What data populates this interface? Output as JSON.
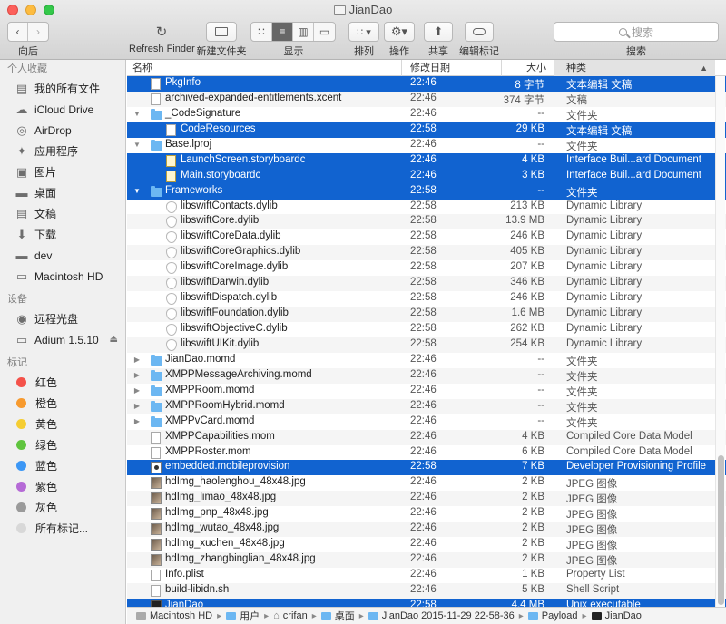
{
  "window": {
    "title": "JianDao"
  },
  "toolbar": {
    "back_label": "向后",
    "refresh_label": "Refresh Finder",
    "new_folder_label": "新建文件夹",
    "view_label": "显示",
    "arrange_label": "排列",
    "action_label": "操作",
    "share_label": "共享",
    "tags_label": "编辑标记",
    "search_label": "搜索",
    "search_placeholder": "搜索"
  },
  "sidebar": {
    "favorites_heading": "个人收藏",
    "favorites": [
      {
        "label": "我的所有文件",
        "icon": "all-files-icon"
      },
      {
        "label": "iCloud Drive",
        "icon": "cloud-icon"
      },
      {
        "label": "AirDrop",
        "icon": "airdrop-icon"
      },
      {
        "label": "应用程序",
        "icon": "applications-icon"
      },
      {
        "label": "图片",
        "icon": "camera-icon"
      },
      {
        "label": "桌面",
        "icon": "desktop-icon"
      },
      {
        "label": "文稿",
        "icon": "documents-icon"
      },
      {
        "label": "下载",
        "icon": "download-icon"
      },
      {
        "label": "dev",
        "icon": "folder-icon"
      },
      {
        "label": "Macintosh HD",
        "icon": "disk-icon"
      }
    ],
    "devices_heading": "设备",
    "devices": [
      {
        "label": "远程光盘",
        "icon": "optical-disc-icon"
      },
      {
        "label": "Adium 1.5.10",
        "icon": "disk-icon"
      }
    ],
    "tags_heading": "标记",
    "tags": [
      {
        "label": "红色",
        "color": "#f4524a"
      },
      {
        "label": "橙色",
        "color": "#f79a2e"
      },
      {
        "label": "黄色",
        "color": "#f5cd32"
      },
      {
        "label": "绿色",
        "color": "#5fc43e"
      },
      {
        "label": "蓝色",
        "color": "#3c97f5"
      },
      {
        "label": "紫色",
        "color": "#b56ad6"
      },
      {
        "label": "灰色",
        "color": "#9a9a9a"
      },
      {
        "label": "所有标记...",
        "color": "#d8d8d8"
      }
    ]
  },
  "columns": {
    "name": "名称",
    "date": "修改日期",
    "size": "大小",
    "kind": "种类"
  },
  "files": [
    {
      "name": "PkgInfo",
      "date": "22:46",
      "size": "8 字节",
      "kind": "文本编辑 文稿",
      "icon": "doc",
      "indent": 1,
      "tri": "",
      "sel": true
    },
    {
      "name": "archived-expanded-entitlements.xcent",
      "date": "22:46",
      "size": "374 字节",
      "kind": "文稿",
      "icon": "doc",
      "indent": 1,
      "tri": "",
      "sel": false
    },
    {
      "name": "_CodeSignature",
      "date": "22:46",
      "size": "--",
      "kind": "文件夹",
      "icon": "folder",
      "indent": 1,
      "tri": "▼",
      "sel": false
    },
    {
      "name": "CodeResources",
      "date": "22:58",
      "size": "29 KB",
      "kind": "文本编辑 文稿",
      "icon": "doc",
      "indent": 2,
      "tri": "",
      "sel": true
    },
    {
      "name": "Base.lproj",
      "date": "22:46",
      "size": "--",
      "kind": "文件夹",
      "icon": "folder",
      "indent": 1,
      "tri": "▼",
      "sel": false
    },
    {
      "name": "LaunchScreen.storyboardc",
      "date": "22:46",
      "size": "4 KB",
      "kind": "Interface Buil...ard Document",
      "icon": "doc-y",
      "indent": 2,
      "tri": "",
      "sel": true
    },
    {
      "name": "Main.storyboardc",
      "date": "22:46",
      "size": "3 KB",
      "kind": "Interface Buil...ard Document",
      "icon": "doc-y",
      "indent": 2,
      "tri": "",
      "sel": true
    },
    {
      "name": "Frameworks",
      "date": "22:58",
      "size": "--",
      "kind": "文件夹",
      "icon": "folder",
      "indent": 1,
      "tri": "▼",
      "sel": true
    },
    {
      "name": "libswiftContacts.dylib",
      "date": "22:58",
      "size": "213 KB",
      "kind": "Dynamic Library",
      "icon": "lib",
      "indent": 2,
      "tri": "",
      "sel": false
    },
    {
      "name": "libswiftCore.dylib",
      "date": "22:58",
      "size": "13.9 MB",
      "kind": "Dynamic Library",
      "icon": "lib",
      "indent": 2,
      "tri": "",
      "sel": false
    },
    {
      "name": "libswiftCoreData.dylib",
      "date": "22:58",
      "size": "246 KB",
      "kind": "Dynamic Library",
      "icon": "lib",
      "indent": 2,
      "tri": "",
      "sel": false
    },
    {
      "name": "libswiftCoreGraphics.dylib",
      "date": "22:58",
      "size": "405 KB",
      "kind": "Dynamic Library",
      "icon": "lib",
      "indent": 2,
      "tri": "",
      "sel": false
    },
    {
      "name": "libswiftCoreImage.dylib",
      "date": "22:58",
      "size": "207 KB",
      "kind": "Dynamic Library",
      "icon": "lib",
      "indent": 2,
      "tri": "",
      "sel": false
    },
    {
      "name": "libswiftDarwin.dylib",
      "date": "22:58",
      "size": "346 KB",
      "kind": "Dynamic Library",
      "icon": "lib",
      "indent": 2,
      "tri": "",
      "sel": false
    },
    {
      "name": "libswiftDispatch.dylib",
      "date": "22:58",
      "size": "246 KB",
      "kind": "Dynamic Library",
      "icon": "lib",
      "indent": 2,
      "tri": "",
      "sel": false
    },
    {
      "name": "libswiftFoundation.dylib",
      "date": "22:58",
      "size": "1.6 MB",
      "kind": "Dynamic Library",
      "icon": "lib",
      "indent": 2,
      "tri": "",
      "sel": false
    },
    {
      "name": "libswiftObjectiveC.dylib",
      "date": "22:58",
      "size": "262 KB",
      "kind": "Dynamic Library",
      "icon": "lib",
      "indent": 2,
      "tri": "",
      "sel": false
    },
    {
      "name": "libswiftUIKit.dylib",
      "date": "22:58",
      "size": "254 KB",
      "kind": "Dynamic Library",
      "icon": "lib",
      "indent": 2,
      "tri": "",
      "sel": false
    },
    {
      "name": "JianDao.momd",
      "date": "22:46",
      "size": "--",
      "kind": "文件夹",
      "icon": "folder",
      "indent": 1,
      "tri": "▶",
      "sel": false
    },
    {
      "name": "XMPPMessageArchiving.momd",
      "date": "22:46",
      "size": "--",
      "kind": "文件夹",
      "icon": "folder",
      "indent": 1,
      "tri": "▶",
      "sel": false
    },
    {
      "name": "XMPPRoom.momd",
      "date": "22:46",
      "size": "--",
      "kind": "文件夹",
      "icon": "folder",
      "indent": 1,
      "tri": "▶",
      "sel": false
    },
    {
      "name": "XMPPRoomHybrid.momd",
      "date": "22:46",
      "size": "--",
      "kind": "文件夹",
      "icon": "folder",
      "indent": 1,
      "tri": "▶",
      "sel": false
    },
    {
      "name": "XMPPvCard.momd",
      "date": "22:46",
      "size": "--",
      "kind": "文件夹",
      "icon": "folder",
      "indent": 1,
      "tri": "▶",
      "sel": false
    },
    {
      "name": "XMPPCapabilities.mom",
      "date": "22:46",
      "size": "4 KB",
      "kind": "Compiled Core Data Model",
      "icon": "doc",
      "indent": 1,
      "tri": "",
      "sel": false
    },
    {
      "name": "XMPPRoster.mom",
      "date": "22:46",
      "size": "6 KB",
      "kind": "Compiled Core Data Model",
      "icon": "doc",
      "indent": 1,
      "tri": "",
      "sel": false
    },
    {
      "name": "embedded.mobileprovision",
      "date": "22:58",
      "size": "7 KB",
      "kind": "Developer Provisioning Profile",
      "icon": "prov",
      "indent": 1,
      "tri": "",
      "sel": true
    },
    {
      "name": "hdImg_haolenghou_48x48.jpg",
      "date": "22:46",
      "size": "2 KB",
      "kind": "JPEG 图像",
      "icon": "img",
      "indent": 1,
      "tri": "",
      "sel": false
    },
    {
      "name": "hdImg_limao_48x48.jpg",
      "date": "22:46",
      "size": "2 KB",
      "kind": "JPEG 图像",
      "icon": "img",
      "indent": 1,
      "tri": "",
      "sel": false
    },
    {
      "name": "hdImg_pnp_48x48.jpg",
      "date": "22:46",
      "size": "2 KB",
      "kind": "JPEG 图像",
      "icon": "img",
      "indent": 1,
      "tri": "",
      "sel": false
    },
    {
      "name": "hdImg_wutao_48x48.jpg",
      "date": "22:46",
      "size": "2 KB",
      "kind": "JPEG 图像",
      "icon": "img",
      "indent": 1,
      "tri": "",
      "sel": false
    },
    {
      "name": "hdImg_xuchen_48x48.jpg",
      "date": "22:46",
      "size": "2 KB",
      "kind": "JPEG 图像",
      "icon": "img",
      "indent": 1,
      "tri": "",
      "sel": false
    },
    {
      "name": "hdImg_zhangbinglian_48x48.jpg",
      "date": "22:46",
      "size": "2 KB",
      "kind": "JPEG 图像",
      "icon": "img",
      "indent": 1,
      "tri": "",
      "sel": false
    },
    {
      "name": "Info.plist",
      "date": "22:46",
      "size": "1 KB",
      "kind": "Property List",
      "icon": "doc",
      "indent": 1,
      "tri": "",
      "sel": false
    },
    {
      "name": "build-libidn.sh",
      "date": "22:46",
      "size": "5 KB",
      "kind": "Shell Script",
      "icon": "doc",
      "indent": 1,
      "tri": "",
      "sel": false
    },
    {
      "name": "JianDao",
      "date": "22:58",
      "size": "4.4 MB",
      "kind": "Unix executable",
      "icon": "exe",
      "indent": 1,
      "tri": "",
      "sel": true
    }
  ],
  "pathbar": [
    {
      "label": "Macintosh HD",
      "icon": "disk"
    },
    {
      "label": "用户",
      "icon": "folder"
    },
    {
      "label": "crifan",
      "icon": "home"
    },
    {
      "label": "桌面",
      "icon": "folder"
    },
    {
      "label": "JianDao 2015-11-29 22-58-36",
      "icon": "folder"
    },
    {
      "label": "Payload",
      "icon": "folder"
    },
    {
      "label": "JianDao",
      "icon": "exe"
    }
  ]
}
